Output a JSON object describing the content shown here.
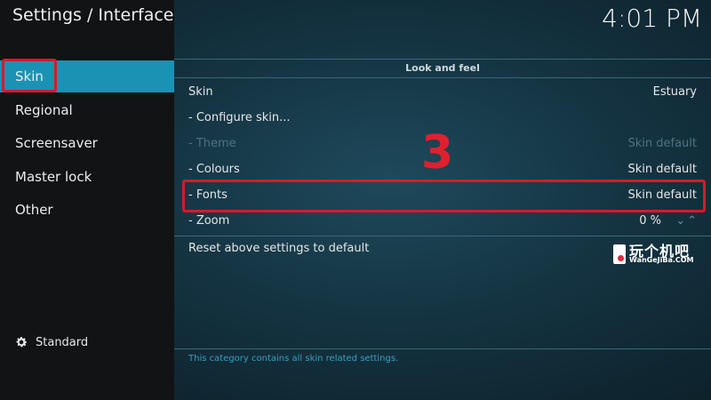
{
  "header": {
    "title": "Settings / Interface",
    "clock": "4:01 PM"
  },
  "sidebar": {
    "items": [
      {
        "label": "Skin"
      },
      {
        "label": "Regional"
      },
      {
        "label": "Screensaver"
      },
      {
        "label": "Master lock"
      },
      {
        "label": "Other"
      }
    ],
    "level_label": "Standard"
  },
  "content": {
    "section": "Look and feel",
    "rows": [
      {
        "label": "Skin",
        "value": "Estuary"
      },
      {
        "label": "- Configure skin...",
        "value": ""
      },
      {
        "label": "- Theme",
        "value": "Skin default"
      },
      {
        "label": "- Colours",
        "value": "Skin default"
      },
      {
        "label": "- Fonts",
        "value": "Skin default"
      },
      {
        "label": "- Zoom",
        "value": "0 %"
      }
    ],
    "reset_label": "Reset above settings to default",
    "footer": "This category contains all skin related settings."
  },
  "annotation": {
    "step": "3"
  },
  "watermark": {
    "title": "玩个机吧",
    "subtitle": "WanGeJiBa.COM"
  },
  "colors": {
    "accent": "#1b92b4",
    "highlight": "#d61a2a",
    "disabled": "#4e7383",
    "footer_text": "#3a9fc0"
  },
  "icons": {
    "standard": "gear-icon",
    "zoom": "chevron-down-up-icon"
  }
}
